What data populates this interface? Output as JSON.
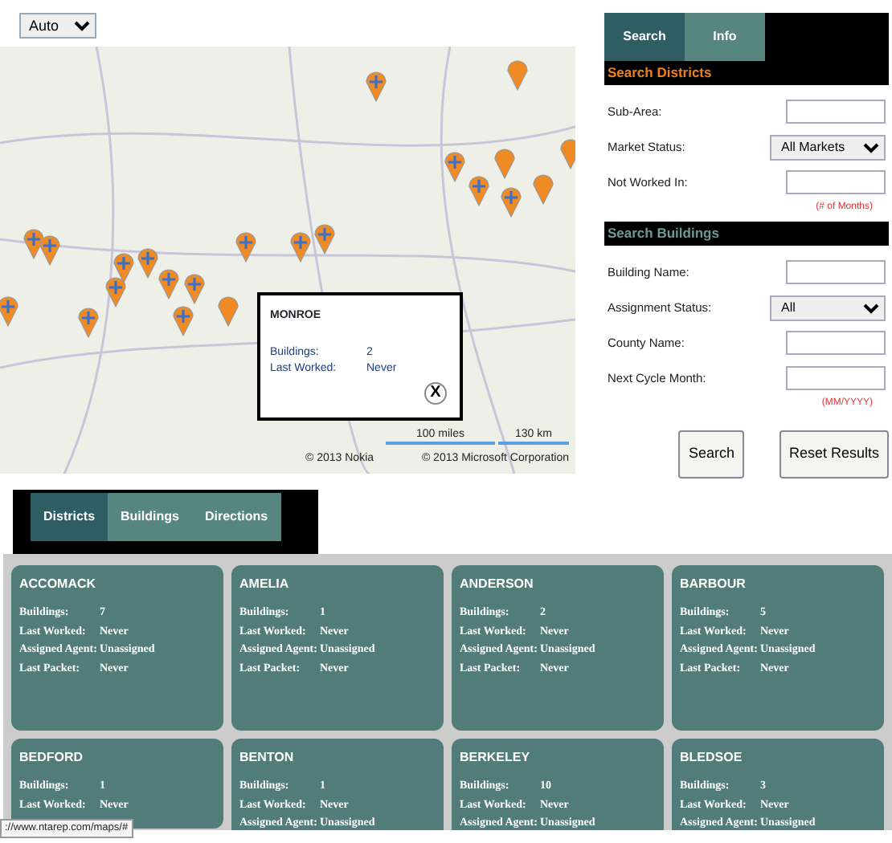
{
  "zoom_select": {
    "value": "Auto"
  },
  "map": {
    "popup": {
      "title": "MONROE",
      "fields": [
        {
          "label": "Buildings:",
          "value": "2"
        },
        {
          "label": "Last Worked:",
          "value": "Never"
        }
      ],
      "close_label": "X"
    },
    "scale": [
      "100 miles",
      "130 km"
    ],
    "copyright": [
      "© 2013 Nokia",
      "© 2013 Microsoft Corporation"
    ]
  },
  "side_tabs": [
    {
      "label": "Search",
      "selected": true
    },
    {
      "label": "Info",
      "selected": false
    }
  ],
  "sections": [
    {
      "title": "Search Districts",
      "kind": "districts",
      "fields": [
        {
          "label": "Sub-Area:",
          "kind": "text"
        },
        {
          "label": "Market Status:",
          "kind": "select",
          "value": "All Markets"
        },
        {
          "label": "Not Worked In:",
          "kind": "text",
          "hint": "(# of Months)"
        }
      ]
    },
    {
      "title": "Search Buildings",
      "kind": "buildings",
      "fields": [
        {
          "label": "Building Name:",
          "kind": "text"
        },
        {
          "label": "Assignment Status:",
          "kind": "select",
          "value": "All"
        },
        {
          "label": "County Name:",
          "kind": "text"
        },
        {
          "label": "Next Cycle Month:",
          "kind": "text",
          "hint": "(MM/YYYY)"
        }
      ]
    }
  ],
  "buttons": [
    "Search",
    "Reset Results"
  ],
  "result_tabs": [
    {
      "label": "Districts",
      "selected": true
    },
    {
      "label": "Buildings",
      "selected": false
    },
    {
      "label": "Directions",
      "selected": false
    }
  ],
  "districts": [
    {
      "name": "ACCOMACK",
      "fields": [
        [
          "Buildings:",
          "7"
        ],
        [
          "Last Worked:",
          "Never"
        ],
        [
          "Assigned Agent:",
          "Unassigned"
        ],
        [
          "Last Packet:",
          "Never"
        ]
      ]
    },
    {
      "name": "AMELIA",
      "fields": [
        [
          "Buildings:",
          "1"
        ],
        [
          "Last Worked:",
          "Never"
        ],
        [
          "Assigned Agent:",
          "Unassigned"
        ],
        [
          "Last Packet:",
          "Never"
        ]
      ]
    },
    {
      "name": "ANDERSON",
      "fields": [
        [
          "Buildings:",
          "2"
        ],
        [
          "Last Worked:",
          "Never"
        ],
        [
          "Assigned Agent:",
          "Unassigned"
        ],
        [
          "Last Packet:",
          "Never"
        ]
      ]
    },
    {
      "name": "BARBOUR",
      "fields": [
        [
          "Buildings:",
          "5"
        ],
        [
          "Last Worked:",
          "Never"
        ],
        [
          "Assigned Agent:",
          "Unassigned"
        ],
        [
          "Last Packet:",
          "Never"
        ]
      ]
    },
    {
      "name": "BEDFORD",
      "fields": [
        [
          "Buildings:",
          "1"
        ],
        [
          "Last Worked:",
          "Never"
        ]
      ]
    },
    {
      "name": "BENTON",
      "fields": [
        [
          "Buildings:",
          "1"
        ],
        [
          "Last Worked:",
          "Never"
        ],
        [
          "Assigned Agent:",
          "Unassigned"
        ]
      ]
    },
    {
      "name": "BERKELEY",
      "fields": [
        [
          "Buildings:",
          "10"
        ],
        [
          "Last Worked:",
          "Never"
        ],
        [
          "Assigned Agent:",
          "Unassigned"
        ]
      ]
    },
    {
      "name": "BLEDSOE",
      "fields": [
        [
          "Buildings:",
          "3"
        ],
        [
          "Last Worked:",
          "Never"
        ],
        [
          "Assigned Agent:",
          "Unassigned"
        ]
      ]
    }
  ],
  "status_bar": {
    "url": "://www.ntarep.com/maps/#"
  }
}
